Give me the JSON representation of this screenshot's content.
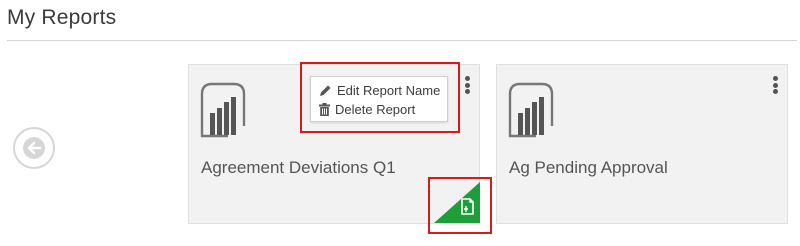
{
  "page": {
    "title": "My Reports"
  },
  "navigation": {
    "back_icon": "arrow-left-circle-icon"
  },
  "reports": [
    {
      "name": "Agreement Deviations Q1",
      "icon": "power-bi-report-icon",
      "menu_icon": "more-vertical-icon",
      "context_menu": {
        "items": [
          {
            "label": "Edit Report Name",
            "icon": "pencil-icon"
          },
          {
            "label": "Delete Report",
            "icon": "trash-icon"
          }
        ]
      },
      "badge": {
        "icon": "document-icon",
        "color": "#1e9e3a"
      }
    },
    {
      "name": "Ag Pending Approval",
      "icon": "power-bi-report-icon",
      "menu_icon": "more-vertical-icon"
    }
  ],
  "colors": {
    "highlight": "#d81a1a",
    "card_background": "#f2f2f2",
    "badge_green": "#1e9e3a"
  }
}
